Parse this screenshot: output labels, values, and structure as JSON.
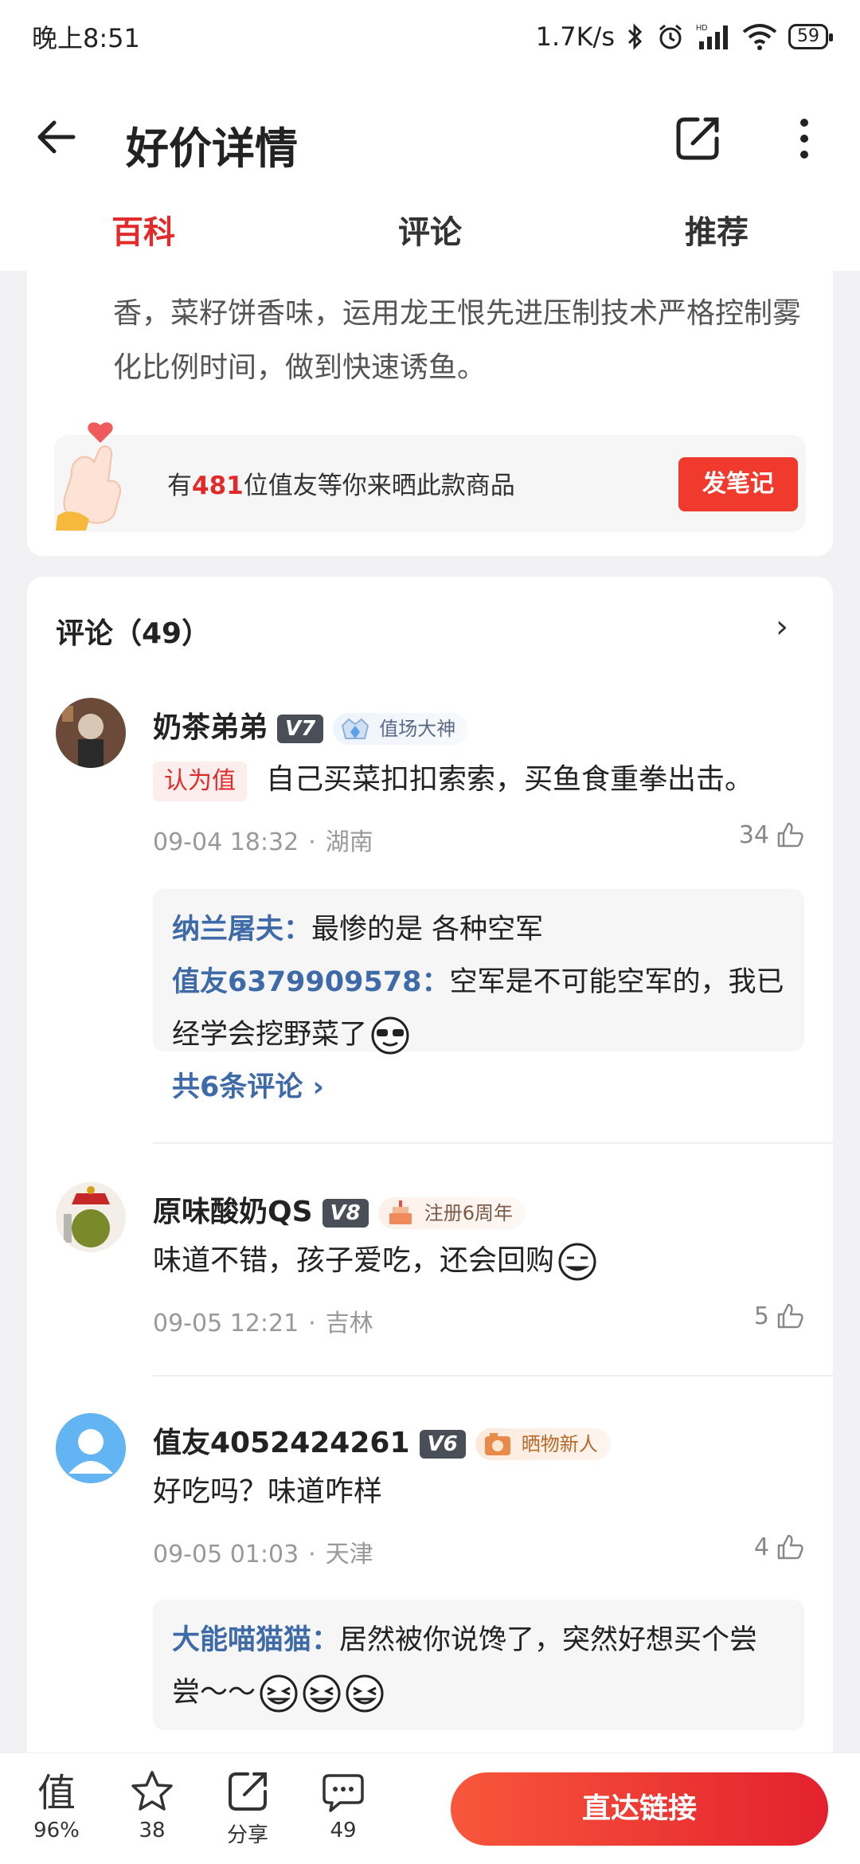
{
  "status_bar": {
    "time": "晚上8:51",
    "net_speed": "1.7K/s",
    "hd_label": "HD",
    "battery": "59"
  },
  "header": {
    "title": "好价详情",
    "tabs": [
      {
        "label": "百科",
        "active": true
      },
      {
        "label": "评论",
        "active": false
      },
      {
        "label": "推荐",
        "active": false
      }
    ]
  },
  "baike": {
    "intro_text": "香，菜籽饼香味，运用龙王恨先进压制技术严格控制雾化比例时间，做到快速诱鱼。",
    "share_prefix": "有",
    "share_count": "481",
    "share_suffix": "位值友等你来晒此款商品",
    "note_button": "发笔记"
  },
  "comments": {
    "title": "评论（49）",
    "items": [
      {
        "user": "奶茶弟弟",
        "level": "V7",
        "badge": "值场大神",
        "tag": "认为值",
        "text": "自己买菜扣扣索索，买鱼食重拳出击。",
        "time": "09-04 18:32",
        "location": "湖南",
        "likes": "34",
        "replies": [
          {
            "name": "纳兰屠夫：",
            "text": "最惨的是 各种空军"
          },
          {
            "name": "值友6379909578：",
            "text": "空军是不可能空军的，我已经学会挖野菜了"
          }
        ],
        "more_replies": "共6条评论 ›"
      },
      {
        "user": "原味酸奶QS",
        "level": "V8",
        "badge": "注册6周年",
        "text": "味道不错，孩子爱吃，还会回购",
        "time": "09-05 12:21",
        "location": "吉林",
        "likes": "5"
      },
      {
        "user": "值友4052424261",
        "level": "V6",
        "badge": "晒物新人",
        "text": "好吃吗？味道咋样",
        "time": "09-05 01:03",
        "location": "天津",
        "likes": "4",
        "replies": [
          {
            "name": "大能喵猫猫：",
            "text": "居然被你说馋了，突然好想买个尝尝～～"
          }
        ]
      }
    ]
  },
  "bottom_bar": {
    "worth_label": "96%",
    "favorite_count": "38",
    "share_label": "分享",
    "comment_count": "49",
    "direct_button": "直达链接"
  },
  "colors": {
    "accent_red": "#e22a2a",
    "reply_name_blue": "#3e6aa8",
    "button_red": "#ef3a2d"
  }
}
